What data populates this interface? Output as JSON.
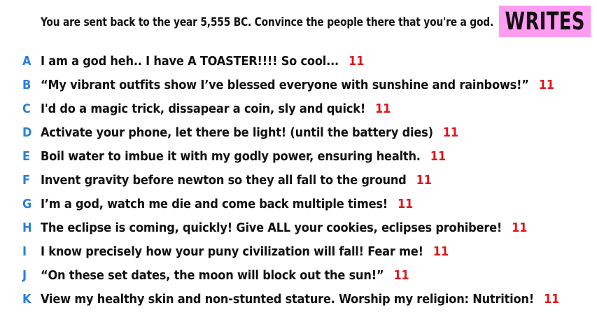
{
  "prompt": "You are sent back to the year 5,555 BC. Convince the people there that you're a god.",
  "mode": {
    "label": "WRITES",
    "color": "#ff9bf0"
  },
  "colors": {
    "letter": "#2b7fd9",
    "score": "#e1141b",
    "text": "#111111"
  },
  "answers": [
    {
      "letter": "A",
      "text": "I am a god heh.. I have A TOASTER!!!! So cool...",
      "score": "11"
    },
    {
      "letter": "B",
      "text": "“My vibrant outfits show I’ve blessed everyone with sunshine and rainbows!”",
      "score": "11"
    },
    {
      "letter": "C",
      "text": "I'd do a magic trick, dissapear a coin, sly and quick!",
      "score": "11"
    },
    {
      "letter": "D",
      "text": "Activate your phone, let there be light! (until the battery dies)",
      "score": "11"
    },
    {
      "letter": "E",
      "text": "Boil water to imbue it with my godly power, ensuring health.",
      "score": "11"
    },
    {
      "letter": "F",
      "text": "Invent gravity before newton so they all fall to the ground",
      "score": "11"
    },
    {
      "letter": "G",
      "text": "I’m a god, watch me die and come back multiple times!",
      "score": "11"
    },
    {
      "letter": "H",
      "text": "The eclipse is coming, quickly! Give ALL your cookies, eclipses prohibere!",
      "score": "11"
    },
    {
      "letter": "I",
      "text": "I know precisely how your puny civilization will fall! Fear me!",
      "score": "11"
    },
    {
      "letter": "J",
      "text": "“On these set dates, the moon will block out the sun!”",
      "score": "11"
    },
    {
      "letter": "K",
      "text": "View my healthy skin and non-stunted stature. Worship my religion: Nutrition!",
      "score": "11"
    }
  ]
}
